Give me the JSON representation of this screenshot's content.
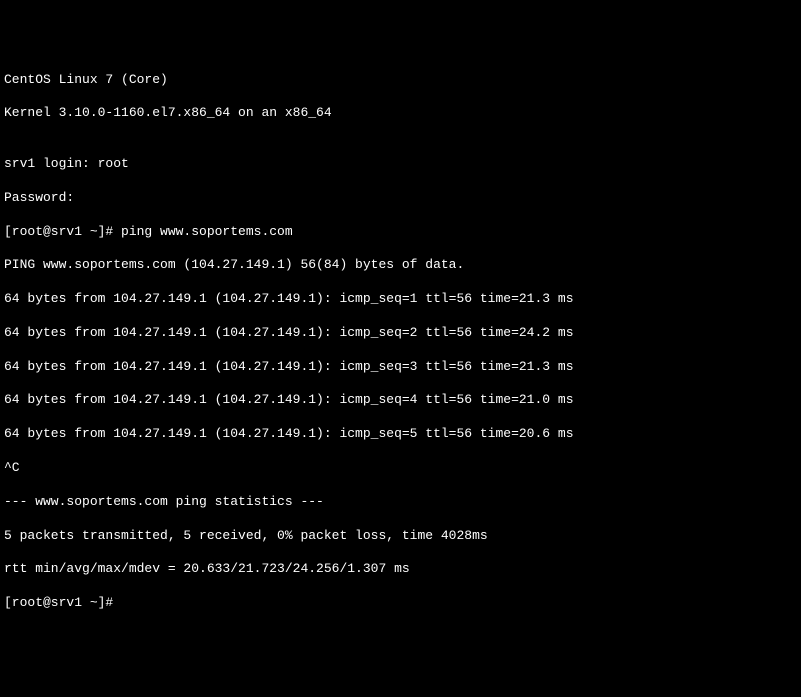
{
  "terminal": {
    "os_name": "CentOS Linux 7 (Core)",
    "kernel_info": "Kernel 3.10.0-1160.el7.x86_64 on an x86_64",
    "blank1": "",
    "login_prompt": "srv1 login: root",
    "password_prompt": "Password:",
    "prompt_with_cmd": "[root@srv1 ~]# ping www.soportems.com",
    "ping_header": "PING www.soportems.com (104.27.149.1) 56(84) bytes of data.",
    "ping_reply1": "64 bytes from 104.27.149.1 (104.27.149.1): icmp_seq=1 ttl=56 time=21.3 ms",
    "ping_reply2": "64 bytes from 104.27.149.1 (104.27.149.1): icmp_seq=2 ttl=56 time=24.2 ms",
    "ping_reply3": "64 bytes from 104.27.149.1 (104.27.149.1): icmp_seq=3 ttl=56 time=21.3 ms",
    "ping_reply4": "64 bytes from 104.27.149.1 (104.27.149.1): icmp_seq=4 ttl=56 time=21.0 ms",
    "ping_reply5": "64 bytes from 104.27.149.1 (104.27.149.1): icmp_seq=5 ttl=56 time=20.6 ms",
    "interrupt": "^C",
    "stats_header": "--- www.soportems.com ping statistics ---",
    "stats_line1": "5 packets transmitted, 5 received, 0% packet loss, time 4028ms",
    "stats_line2": "rtt min/avg/max/mdev = 20.633/21.723/24.256/1.307 ms",
    "final_prompt": "[root@srv1 ~]# "
  }
}
